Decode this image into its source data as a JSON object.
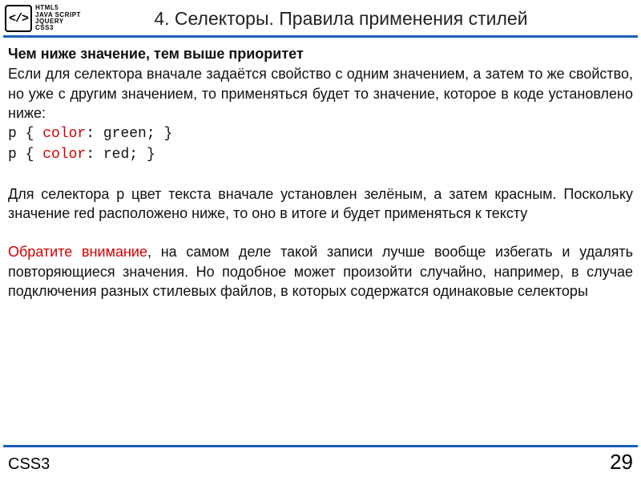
{
  "logo": {
    "badge": "</>",
    "lines": [
      "HTML5",
      "JAVA SCRIPT",
      "JQUERY",
      "CSS3"
    ]
  },
  "title": "4. Селекторы. Правила применения стилей",
  "subheading": "Чем ниже значение, тем выше приоритет",
  "para1": "Если для селектора вначале задаётся свойство с одним значением, а затем то же свойство, но уже с другим значением, то применяться будет то значение, которое в коде установлено ниже:",
  "code": {
    "line1_a": "p { ",
    "line1_kw": "color",
    "line1_b": ": green; }",
    "line2_a": "p { ",
    "line2_kw": "color",
    "line2_b": ": red; }"
  },
  "para2": "Для селектора p цвет текста вначале установлен зелёным, а затем красным. Поскольку значение red расположено ниже, то оно в итоге и будет применяться к тексту",
  "note_lead": "Обратите внимание",
  "note_rest": ", на самом деле такой записи лучше вообще избегать и удалять повторяющиеся значения. Но подобное может произойти случайно, например, в случае подключения разных стилевых файлов, в которых содержатся одинаковые селекторы",
  "footer_label": "CSS3",
  "page_number": "29"
}
